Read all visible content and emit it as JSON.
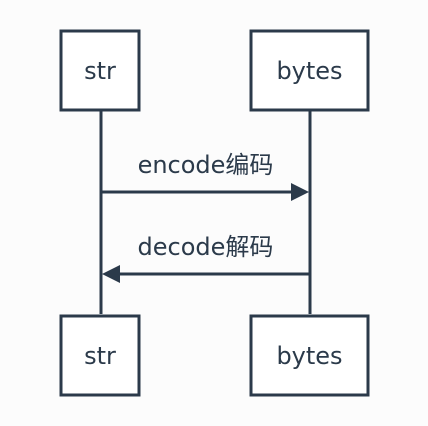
{
  "colors": {
    "background": "#fcfcfc",
    "stroke": "#2b3a4a",
    "box_fill": "#ffffff"
  },
  "participants": {
    "top_left": "str",
    "top_right": "bytes",
    "bottom_left": "str",
    "bottom_right": "bytes"
  },
  "messages": {
    "encode": "encode编码",
    "decode": "decode解码"
  }
}
